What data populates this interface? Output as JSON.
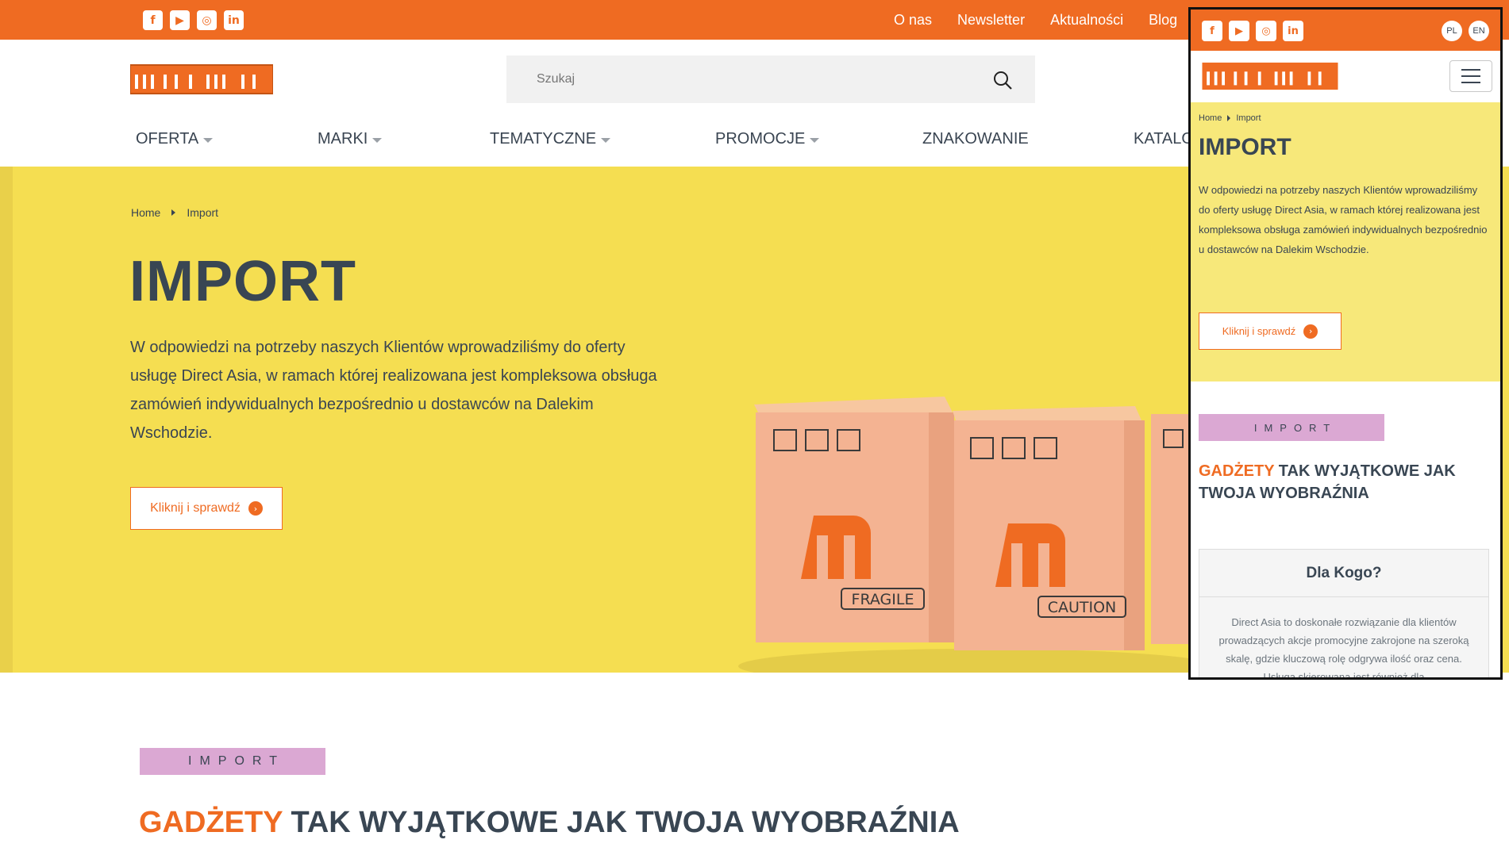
{
  "topbar": {
    "links": [
      "O nas",
      "Newsletter",
      "Aktualności",
      "Blog"
    ]
  },
  "search": {
    "placeholder": "Szukaj"
  },
  "nav": {
    "items": [
      {
        "label": "OFERTA"
      },
      {
        "label": "MARKI"
      },
      {
        "label": "TEMATYCZNE"
      },
      {
        "label": "PROMOCJE"
      },
      {
        "label": "ZNAKOWANIE"
      },
      {
        "label": "KATALO"
      }
    ]
  },
  "hero": {
    "breadcrumb": [
      "Home",
      "Import"
    ],
    "title": "IMPORT",
    "text": "W odpowiedzi na potrzeby naszych Klientów wprowadziliśmy do oferty usługę Direct Asia, w ramach której realizowana jest kompleksowa obsługa zamówień indywidualnych bezpośrednio u dostawców na Dalekim Wschodzie.",
    "button": "Kliknij i sprawdź",
    "box_labels": [
      "FRAGILE",
      "CAUTION"
    ]
  },
  "section": {
    "tag": "IMPORT",
    "title_accent": "GADŻETY",
    "title_rest": "TAK WYJĄTKOWE JAK TWOJA WYOBRAŹNIA"
  },
  "mobile": {
    "lang": [
      "PL",
      "EN"
    ],
    "breadcrumb": [
      "Home",
      "Import"
    ],
    "title": "IMPORT",
    "text": "W odpowiedzi na potrzeby naszych Klientów wprowadziliśmy do oferty usługę Direct Asia, w ramach której realizowana jest kompleksowa obsługa zamówień indywidualnych bezpośrednio u dostawców na Dalekim Wschodzie.",
    "button": "Kliknij i sprawdź",
    "tag": "IMPORT",
    "title_accent": "GADŻETY",
    "title_rest": "TAK WYJĄTKOWE JAK TWOJA WYOBRAŹNIA",
    "card_title": "Dla Kogo?",
    "card_text": "Direct Asia to doskonałe rozwiązanie dla klientów prowadzących akcje promocyjne zakrojone na szeroką skalę, gdzie kluczową rolę odgrywa ilość oraz cena. Usługa skierowana jest również dla"
  },
  "colors": {
    "brand_orange": "#ef6b22",
    "hero_yellow": "#f5de51",
    "tag_pink": "#dba8d3",
    "text_dark": "#394653"
  },
  "icons": [
    "facebook-icon",
    "youtube-icon",
    "instagram-icon",
    "linkedin-icon",
    "search-icon",
    "arrow-right-icon",
    "hamburger-icon"
  ]
}
